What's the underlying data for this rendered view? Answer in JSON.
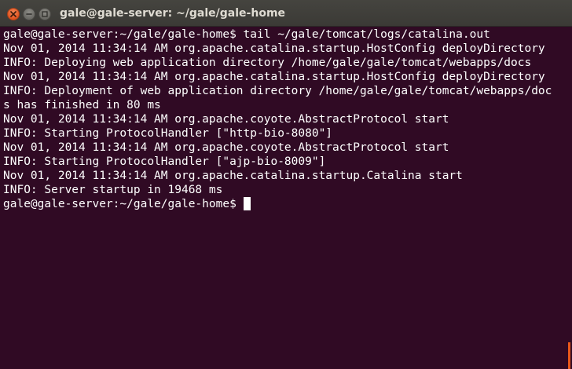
{
  "window": {
    "title": "gale@gale-server: ~/gale/gale-home"
  },
  "terminal": {
    "lines": [
      "gale@gale-server:~/gale/gale-home$ tail ~/gale/tomcat/logs/catalina.out",
      "Nov 01, 2014 11:34:14 AM org.apache.catalina.startup.HostConfig deployDirectory",
      "INFO: Deploying web application directory /home/gale/gale/tomcat/webapps/docs",
      "Nov 01, 2014 11:34:14 AM org.apache.catalina.startup.HostConfig deployDirectory",
      "INFO: Deployment of web application directory /home/gale/gale/tomcat/webapps/doc",
      "s has finished in 80 ms",
      "Nov 01, 2014 11:34:14 AM org.apache.coyote.AbstractProtocol start",
      "INFO: Starting ProtocolHandler [\"http-bio-8080\"]",
      "Nov 01, 2014 11:34:14 AM org.apache.coyote.AbstractProtocol start",
      "INFO: Starting ProtocolHandler [\"ajp-bio-8009\"]",
      "Nov 01, 2014 11:34:14 AM org.apache.catalina.startup.Catalina start",
      "INFO: Server startup in 19468 ms"
    ],
    "prompt": "gale@gale-server:~/gale/gale-home$"
  },
  "colors": {
    "background": "#300a24",
    "text": "#ffffff",
    "titlebar": "#3c3b37",
    "close_button": "#e95420"
  },
  "icons": {
    "close": "close-icon",
    "minimize": "minimize-icon",
    "maximize": "maximize-icon"
  }
}
